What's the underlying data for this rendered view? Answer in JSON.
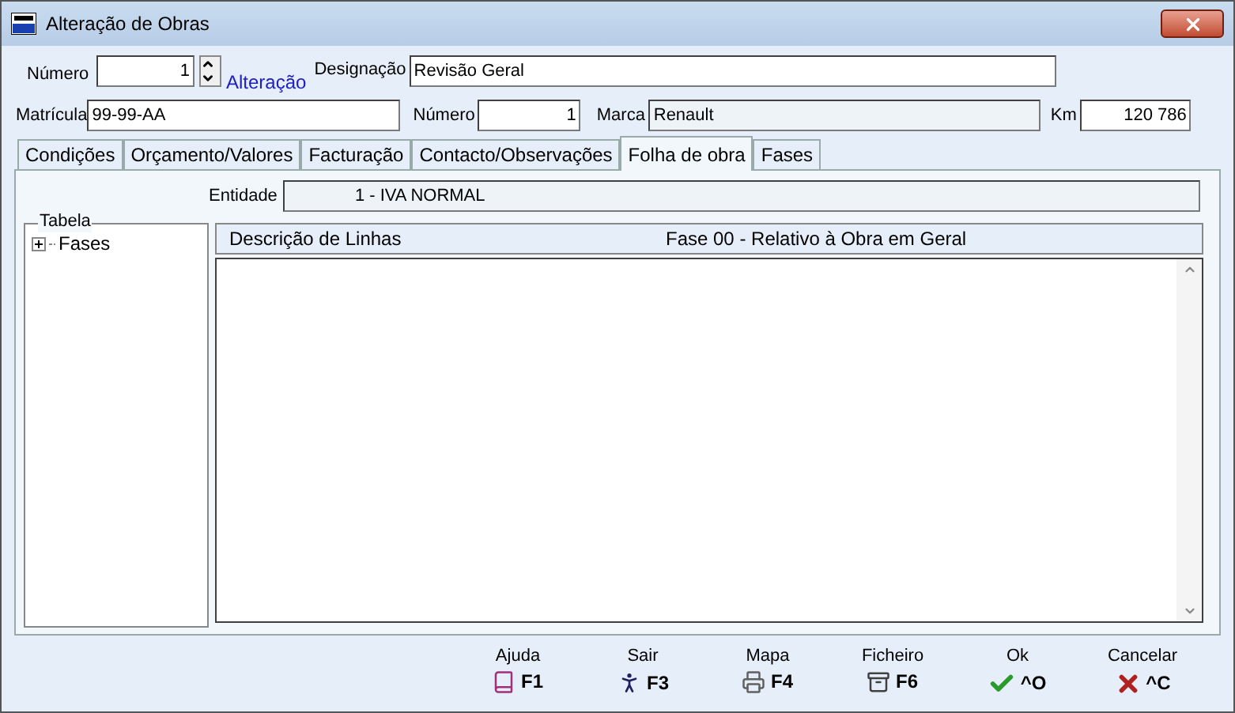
{
  "window": {
    "title": "Alteração de Obras"
  },
  "header": {
    "numero_label": "Número",
    "numero_value": "1",
    "alteracao_link": "Alteração",
    "designacao_label": "Designação",
    "designacao_value": "Revisão Geral",
    "matricula_label": "Matrícula",
    "matricula_value": "99-99-AA",
    "numero2_label": "Número",
    "numero2_value": "1",
    "marca_label": "Marca",
    "marca_value": "Renault",
    "km_label": "Km",
    "km_value": "120 786"
  },
  "tabs": [
    {
      "label": "Condições",
      "selected": false
    },
    {
      "label": "Orçamento/Valores",
      "selected": false
    },
    {
      "label": "Facturação",
      "selected": false
    },
    {
      "label": "Contacto/Observações",
      "selected": false
    },
    {
      "label": "Folha de obra",
      "selected": true
    },
    {
      "label": "Fases",
      "selected": false
    }
  ],
  "entidade": {
    "label": "Entidade",
    "value": "1 - IVA NORMAL"
  },
  "tabela": {
    "title": "Tabela",
    "tree": [
      {
        "label": "Fases",
        "expanded": false
      }
    ]
  },
  "lines": {
    "column_1": "Descrição de Linhas",
    "column_2": "Fase 00 - Relativo à Obra em Geral"
  },
  "buttons": [
    {
      "kind": "help",
      "label": "Ajuda",
      "key": "F1"
    },
    {
      "kind": "exit",
      "label": "Sair",
      "key": "F3"
    },
    {
      "kind": "print",
      "label": "Mapa",
      "key": "F4"
    },
    {
      "kind": "file",
      "label": "Ficheiro",
      "key": "F6"
    },
    {
      "kind": "ok",
      "label": "Ok",
      "key": "^O"
    },
    {
      "kind": "cancel",
      "label": "Cancelar",
      "key": "^C"
    }
  ]
}
